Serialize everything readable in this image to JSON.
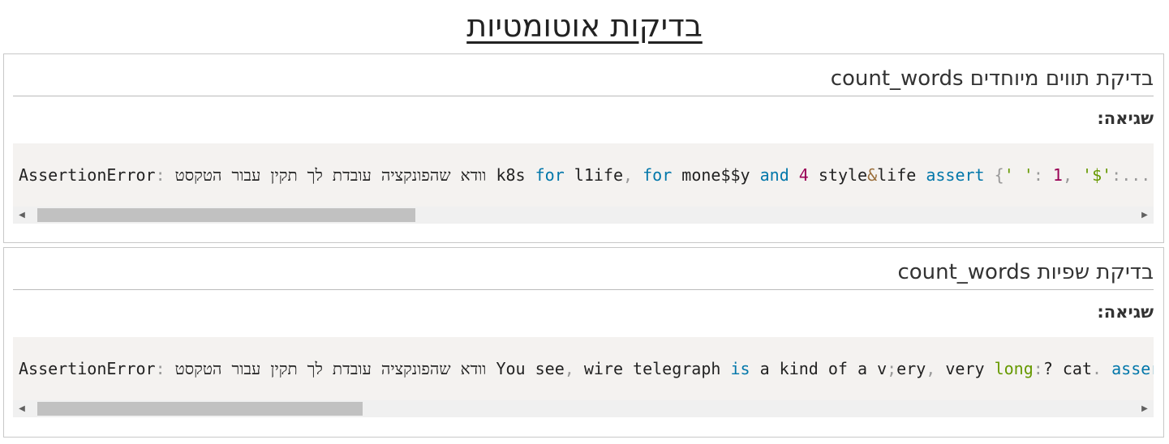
{
  "page": {
    "title": "בדיקות אוטומטיות"
  },
  "tests": [
    {
      "heading": "בדיקת תווים מיוחדים count_words",
      "error_label": "שגיאה:",
      "code": {
        "p1": "AssertionError",
        "p2": ":",
        "p3": " וודא שהפונקציה עובדת לך תקין עבור הטקסט k8s ",
        "p4": "for",
        "p5": " l1ife",
        "p6": ",",
        "p7": " ",
        "p8": "for",
        "p9": " mone$$y ",
        "p10": "and",
        "p11": " ",
        "p12": "4",
        "p13": " style",
        "p14": "&",
        "p15": "life ",
        "p16": "assert",
        "p17": " ",
        "p18": "{",
        "p19": "' '",
        "p20": ":",
        "p21": " ",
        "p22": "1",
        "p23": ",",
        "p24": " ",
        "p25": "'$'",
        "p26": ":..."
      }
    },
    {
      "heading": "בדיקת שפיות count_words",
      "error_label": "שגיאה:",
      "code": {
        "p1": "AssertionError",
        "p2": ":",
        "p3": " וודא שהפונקציה עובדת לך תקין עבור הטקסט You see",
        "p4": ",",
        "p5": " wire telegraph ",
        "p6": "is",
        "p7": " a kind of a v",
        "p8": ";",
        "p9": "ery",
        "p10": ",",
        "p11": " very ",
        "p12": "long",
        "p13": ":",
        "p14": "? cat",
        "p15": ".",
        "p16": " ",
        "p17": "assert"
      }
    }
  ],
  "scrollbar": {
    "left_arrow": "◀",
    "right_arrow": "▶"
  }
}
